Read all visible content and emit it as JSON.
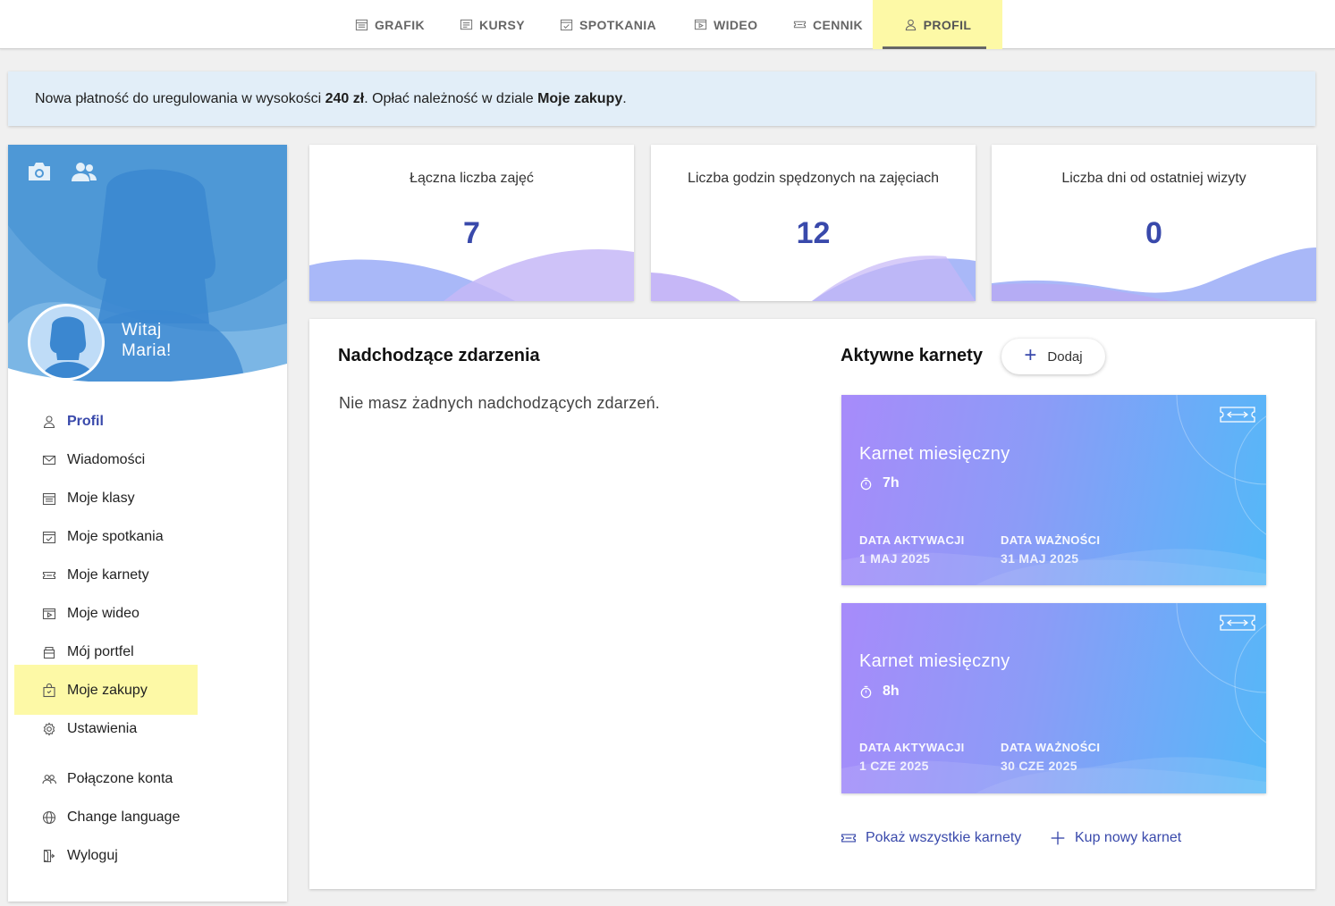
{
  "nav": {
    "tabs": [
      {
        "label": "GRAFIK",
        "icon": "calendar-icon"
      },
      {
        "label": "KURSY",
        "icon": "list-icon"
      },
      {
        "label": "SPOTKANIA",
        "icon": "calendar-check-icon"
      },
      {
        "label": "WIDEO",
        "icon": "video-icon"
      },
      {
        "label": "CENNIK",
        "icon": "ticket-icon"
      },
      {
        "label": "PROFIL",
        "icon": "user-icon"
      }
    ],
    "active": "PROFIL"
  },
  "notice": {
    "prefix": "Nowa płatność do uregulowania w wysokości ",
    "amount": "240 zł",
    "middle": ". Opłać należność w dziale ",
    "section": "Moje zakupy",
    "suffix": "."
  },
  "sidebar": {
    "greeting_line1": "Witaj",
    "greeting_line2": "Maria!",
    "items": [
      {
        "label": "Profil",
        "icon": "user-icon"
      },
      {
        "label": "Wiadomości",
        "icon": "envelope-icon"
      },
      {
        "label": "Moje klasy",
        "icon": "calendar-icon"
      },
      {
        "label": "Moje spotkania",
        "icon": "calendar-check-icon"
      },
      {
        "label": "Moje karnety",
        "icon": "ticket-icon"
      },
      {
        "label": "Moje wideo",
        "icon": "video-icon"
      },
      {
        "label": "Mój portfel",
        "icon": "wallet-icon"
      },
      {
        "label": "Moje zakupy",
        "icon": "shopping-bag-icon"
      },
      {
        "label": "Ustawienia",
        "icon": "gear-icon"
      },
      {
        "label": "Połączone konta",
        "icon": "users-icon"
      },
      {
        "label": "Change language",
        "icon": "globe-icon"
      },
      {
        "label": "Wyloguj",
        "icon": "logout-icon"
      }
    ]
  },
  "stats": [
    {
      "label": "Łączna liczba zajęć",
      "value": "7"
    },
    {
      "label": "Liczba godzin spędzonych na zajęciach",
      "value": "12"
    },
    {
      "label": "Liczba dni od ostatniej wizyty",
      "value": "0"
    }
  ],
  "events": {
    "title": "Nadchodzące zdarzenia",
    "empty": "Nie masz żadnych nadchodzących zdarzeń."
  },
  "passes": {
    "title": "Aktywne karnety",
    "add_label": "Dodaj",
    "items": [
      {
        "name": "Karnet miesięczny",
        "duration": "7h",
        "activation_label": "DATA AKTYWACJI",
        "activation": "1 MAJ 2025",
        "expiry_label": "DATA WAŻNOŚCI",
        "expiry": "31 MAJ 2025"
      },
      {
        "name": "Karnet miesięczny",
        "duration": "8h",
        "activation_label": "DATA AKTYWACJI",
        "activation": "1 CZE 2025",
        "expiry_label": "DATA WAŻNOŚCI",
        "expiry": "30 CZE 2025"
      }
    ],
    "show_all": "Pokaż wszystkie karnety",
    "buy_new": "Kup nowy karnet"
  },
  "colors": {
    "accent": "#3949ab",
    "highlight": "#fdf9a6",
    "notice_bg": "#e2eef8"
  }
}
